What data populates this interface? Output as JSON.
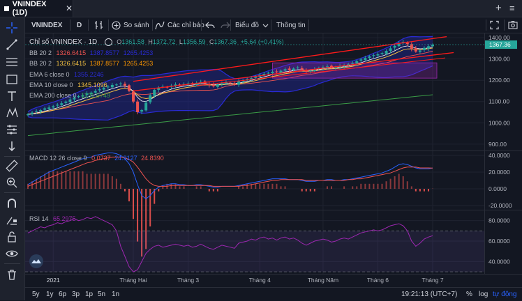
{
  "window": {
    "tab_title": "VNINDEX (1D)",
    "close": "✕",
    "add": "+",
    "menu": "≡"
  },
  "toolbar": {
    "symbol": "VNINDEX",
    "interval": "D",
    "compare": "So sánh",
    "indicators": "Các chỉ báo",
    "chart_type": "Biểu đồ",
    "info": "Thông tin"
  },
  "legend": {
    "title": "Chỉ số VNINDEX · 1D",
    "ohlc": {
      "o_label": "O",
      "o": "1361.58",
      "h_label": "H",
      "h": "1372.72",
      "l_label": "L",
      "l": "1356.59",
      "c_label": "C",
      "c": "1367.36",
      "change": "+5.64 (+0.41%)"
    },
    "bb1": {
      "label": "BB 20 2",
      "v1": "1326.6415",
      "v2": "1387.8577",
      "v3": "1265.4253"
    },
    "bb2": {
      "label": "BB 20 2",
      "v1": "1326.6415",
      "v2": "1387.8577",
      "v3": "1265.4253"
    },
    "ema6": {
      "label": "EMA 6 close 0",
      "value": "1355.2246"
    },
    "ema10": {
      "label": "EMA 10 close 0",
      "value": "1345.1096"
    },
    "ema200": {
      "label": "EMA 200 close 0",
      "value": "1131.6749"
    },
    "macd": {
      "label": "MACD 12 26 close 9",
      "hist": "0.0737",
      "macd": "24.9127",
      "signal": "24.8390"
    },
    "rsi": {
      "label": "RSI 14",
      "value": "65.2975"
    }
  },
  "price_axis": {
    "ticks": [
      "1400.00",
      "1300.00",
      "1200.00",
      "1100.00",
      "1000.00",
      "900.00"
    ],
    "current": "1367.36"
  },
  "macd_axis": {
    "ticks": [
      "40.0000",
      "20.0000",
      "0.0000",
      "-20.0000"
    ]
  },
  "rsi_axis": {
    "ticks": [
      "80.0000",
      "60.0000",
      "40.0000"
    ]
  },
  "time_axis": {
    "labels": [
      "2021",
      "Tháng Hai",
      "Tháng 3",
      "Tháng 4",
      "Tháng Năm",
      "Tháng 6",
      "Tháng 7"
    ]
  },
  "bottom": {
    "ranges": [
      "5y",
      "1y",
      "6p",
      "3p",
      "1p",
      "5n",
      "1n"
    ],
    "clock": "19:21:13 (UTC+7)",
    "percent": "%",
    "log": "log",
    "auto": "tự động"
  },
  "colors": {
    "bg": "#131722",
    "up": "#26a69a",
    "down": "#ef5350",
    "accent": "#2962ff",
    "trend": "#ff1a1a",
    "bb_band": "#2a2bd6",
    "ema6": "#ffffff",
    "ema10": "#f5c242",
    "ema200": "#3a9b46",
    "rsi": "#9c27b0"
  },
  "chart_data": [
    {
      "type": "candlestick",
      "title": "Chỉ số VNINDEX · 1D",
      "x": [
        "2021",
        "Tháng Hai",
        "Tháng 3",
        "Tháng 4",
        "Tháng Năm",
        "Tháng 6",
        "Tháng 7"
      ],
      "ylim": [
        870,
        1420
      ],
      "close": [
        1040,
        1048,
        1055,
        1060,
        1068,
        1072,
        1078,
        1085,
        1092,
        1100,
        1110,
        1118,
        1125,
        1130,
        1138,
        1142,
        1150,
        1158,
        1165,
        1170,
        1178,
        1180,
        1185,
        1175,
        1150,
        1100,
        1050,
        1060,
        1095,
        1130,
        1155,
        1165,
        1170,
        1168,
        1175,
        1180,
        1178,
        1182,
        1185,
        1180,
        1188,
        1192,
        1185,
        1178,
        1172,
        1180,
        1186,
        1190,
        1185,
        1182,
        1195,
        1200,
        1205,
        1210,
        1218,
        1225,
        1230,
        1235,
        1240,
        1238,
        1245,
        1252,
        1248,
        1255,
        1260,
        1250,
        1240,
        1245,
        1252,
        1258,
        1262,
        1265,
        1258,
        1260,
        1268,
        1272,
        1275,
        1280,
        1290,
        1298,
        1305,
        1312,
        1318,
        1322,
        1328,
        1338,
        1350,
        1362,
        1375,
        1380,
        1370,
        1348,
        1335,
        1340,
        1352,
        1360,
        1367
      ],
      "ema200": [
        940,
        942,
        944,
        946,
        948,
        950,
        952,
        954,
        956,
        958,
        960,
        962,
        964,
        966,
        968,
        970,
        972,
        974,
        976,
        978,
        980,
        982,
        984,
        986,
        988,
        990,
        992,
        994,
        996,
        998,
        1000,
        1002,
        1004,
        1006,
        1008,
        1010,
        1012,
        1014,
        1016,
        1018,
        1020,
        1022,
        1024,
        1026,
        1028,
        1030,
        1032,
        1034,
        1036,
        1038,
        1040,
        1042,
        1044,
        1046,
        1048,
        1050,
        1052,
        1054,
        1056,
        1058,
        1060,
        1062,
        1064,
        1066,
        1068,
        1070,
        1072,
        1074,
        1076,
        1078,
        1080,
        1082,
        1084,
        1086,
        1088,
        1090,
        1092,
        1094,
        1096,
        1098,
        1100,
        1102,
        1104,
        1106,
        1108,
        1110,
        1112,
        1114,
        1116,
        1118,
        1120,
        1122,
        1124,
        1126,
        1128,
        1130,
        1132
      ]
    },
    {
      "type": "line",
      "title": "MACD 12 26 close 9",
      "ylim": [
        -25,
        45
      ],
      "macd": [
        5,
        8,
        11,
        14,
        17,
        20,
        22,
        24,
        26,
        28,
        30,
        32,
        34,
        36,
        37,
        38,
        40,
        41,
        42,
        43,
        43,
        42,
        40,
        36,
        30,
        20,
        5,
        -8,
        -12,
        -8,
        -2,
        2,
        4,
        5,
        6,
        6,
        5,
        5,
        4,
        4,
        5,
        5,
        4,
        3,
        2,
        2,
        3,
        3,
        3,
        3,
        4,
        5,
        6,
        7,
        8,
        9,
        10,
        11,
        12,
        12,
        12,
        12,
        11,
        11,
        11,
        10,
        9,
        9,
        9,
        10,
        10,
        11,
        11,
        10,
        10,
        11,
        11,
        12,
        13,
        14,
        15,
        16,
        17,
        18,
        19,
        21,
        23,
        26,
        29,
        30,
        29,
        27,
        25,
        24,
        24,
        24,
        24.9
      ],
      "signal": [
        3,
        5,
        7,
        9,
        11,
        13,
        15,
        17,
        19,
        21,
        23,
        25,
        27,
        29,
        31,
        32,
        34,
        35,
        36,
        37,
        38,
        38,
        38,
        37,
        35,
        32,
        26,
        19,
        12,
        7,
        4,
        3,
        3,
        3,
        4,
        4,
        4,
        4,
        4,
        4,
        4,
        4,
        4,
        4,
        3,
        3,
        3,
        3,
        3,
        3,
        3,
        4,
        4,
        5,
        6,
        7,
        8,
        9,
        10,
        10,
        11,
        11,
        11,
        11,
        11,
        11,
        10,
        10,
        10,
        10,
        10,
        10,
        10,
        10,
        10,
        10,
        11,
        11,
        12,
        12,
        13,
        14,
        15,
        16,
        17,
        18,
        19,
        21,
        23,
        25,
        26,
        26,
        26,
        25,
        25,
        25,
        24.8
      ]
    },
    {
      "type": "line",
      "title": "RSI 14",
      "ylim": [
        28,
        90
      ],
      "values": [
        68,
        70,
        72,
        74,
        73,
        75,
        76,
        78,
        77,
        79,
        80,
        82,
        80,
        81,
        83,
        82,
        84,
        82,
        80,
        78,
        76,
        70,
        55,
        45,
        35,
        30,
        32,
        40,
        48,
        52,
        55,
        56,
        54,
        55,
        56,
        57,
        56,
        55,
        56,
        54,
        55,
        57,
        55,
        53,
        52,
        54,
        56,
        55,
        54,
        53,
        58,
        59,
        60,
        62,
        61,
        63,
        64,
        62,
        63,
        61,
        63,
        64,
        62,
        63,
        61,
        58,
        56,
        58,
        60,
        61,
        62,
        61,
        59,
        60,
        62,
        63,
        62,
        64,
        66,
        68,
        69,
        70,
        71,
        70,
        71,
        73,
        75,
        76,
        77,
        75,
        70,
        60,
        55,
        58,
        62,
        64,
        65.3
      ]
    }
  ]
}
